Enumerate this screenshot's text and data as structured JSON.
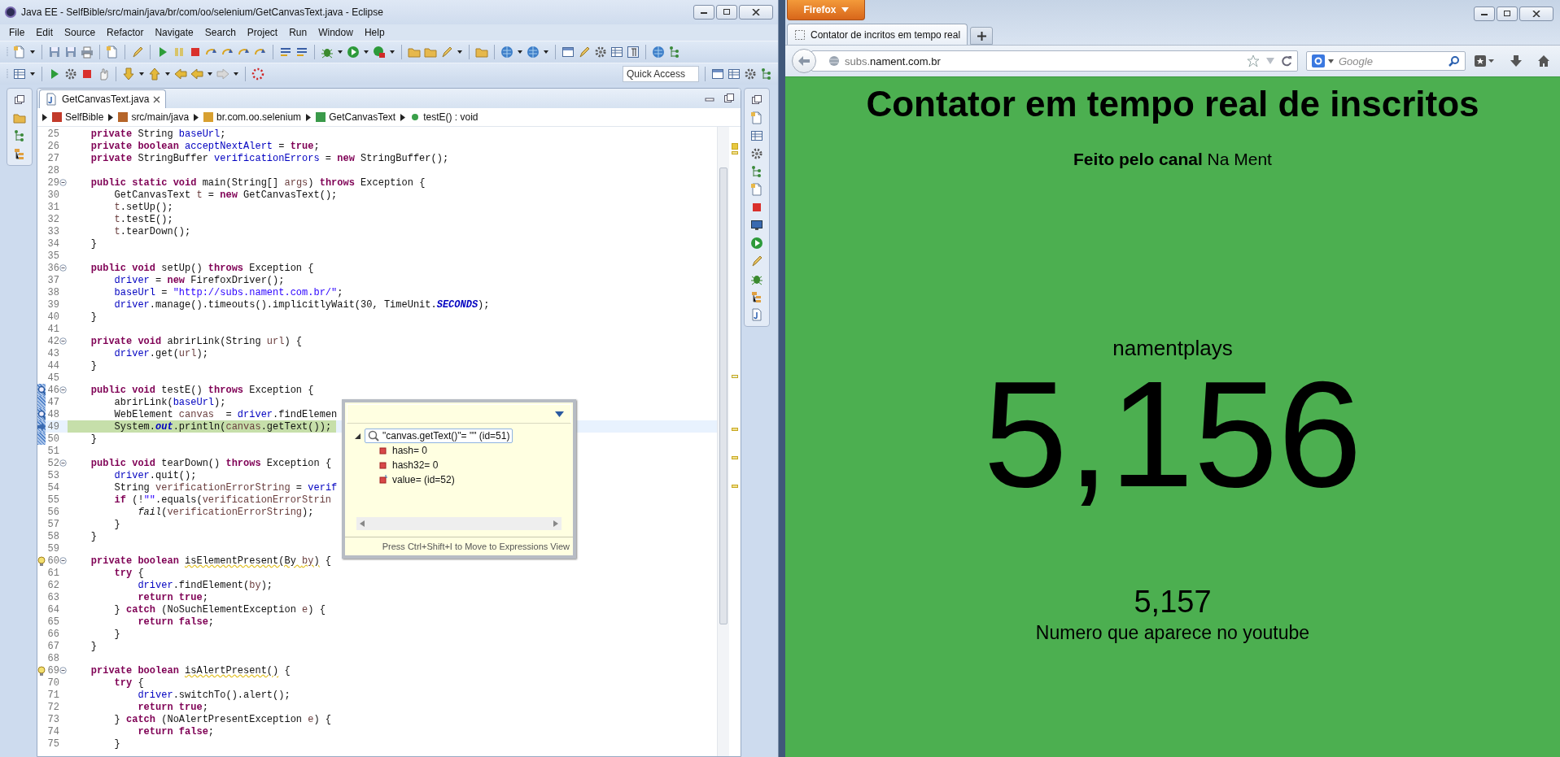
{
  "eclipse": {
    "title": "Java EE - SelfBible/src/main/java/br/com/oo/selenium/GetCanvasText.java - Eclipse",
    "menu": [
      "File",
      "Edit",
      "Source",
      "Refactor",
      "Navigate",
      "Search",
      "Project",
      "Run",
      "Window",
      "Help"
    ],
    "quick_access": {
      "placeholder": "Quick Access"
    },
    "editor_tabs": [
      {
        "label": "GetCanvasText.java",
        "selected": true
      }
    ],
    "breadcrumb": [
      {
        "label": "SelfBible",
        "kind": "project"
      },
      {
        "label": "src/main/java",
        "kind": "source"
      },
      {
        "label": "br.com.oo.selenium",
        "kind": "package"
      },
      {
        "label": "GetCanvasText",
        "kind": "class"
      },
      {
        "label": "testE() : void",
        "kind": "method"
      }
    ],
    "lines": [
      {
        "n": "25",
        "fold": false,
        "current": false,
        "t": [
          {
            "kind": "keyword",
            "text": "    private"
          },
          {
            "kind": "plain",
            "text": " String "
          },
          {
            "kind": "field",
            "text": "baseUrl"
          },
          {
            "kind": "plain",
            "text": ";"
          }
        ]
      },
      {
        "n": "26",
        "fold": false,
        "current": false,
        "t": [
          {
            "kind": "keyword",
            "text": "    private"
          },
          {
            "kind": "keyword",
            "text": " boolean"
          },
          {
            "kind": "field",
            "text": " acceptNextAlert"
          },
          {
            "kind": "plain",
            "text": " = "
          },
          {
            "kind": "keyword",
            "text": "true"
          },
          {
            "kind": "plain",
            "text": ";"
          }
        ]
      },
      {
        "n": "27",
        "fold": false,
        "current": false,
        "t": [
          {
            "kind": "keyword",
            "text": "    private"
          },
          {
            "kind": "plain",
            "text": " StringBuffer "
          },
          {
            "kind": "field",
            "text": "verificationErrors"
          },
          {
            "kind": "plain",
            "text": " = "
          },
          {
            "kind": "keyword",
            "text": "new"
          },
          {
            "kind": "plain",
            "text": " StringBuffer();"
          }
        ]
      },
      {
        "n": "28",
        "fold": false,
        "current": false
      },
      {
        "n": "29",
        "fold": true,
        "current": false,
        "t": [
          {
            "kind": "keyword",
            "text": "    public"
          },
          {
            "kind": "keyword",
            "text": " static"
          },
          {
            "kind": "keyword",
            "text": " void"
          },
          {
            "kind": "plain",
            "text": " main(String[] "
          },
          {
            "kind": "local",
            "text": "args"
          },
          {
            "kind": "plain",
            "text": ") "
          },
          {
            "kind": "keyword",
            "text": "throws"
          },
          {
            "kind": "plain",
            "text": " Exception {"
          }
        ]
      },
      {
        "n": "30",
        "fold": false,
        "current": false,
        "t": [
          {
            "kind": "plain",
            "text": "        GetCanvasText "
          },
          {
            "kind": "local",
            "text": "t"
          },
          {
            "kind": "plain",
            "text": " = "
          },
          {
            "kind": "keyword",
            "text": "new"
          },
          {
            "kind": "plain",
            "text": " GetCanvasText();"
          }
        ]
      },
      {
        "n": "31",
        "fold": false,
        "current": false,
        "t": [
          {
            "kind": "local",
            "text": "        t"
          },
          {
            "kind": "plain",
            "text": ".setUp();"
          }
        ]
      },
      {
        "n": "32",
        "fold": false,
        "current": false,
        "t": [
          {
            "kind": "local",
            "text": "        t"
          },
          {
            "kind": "plain",
            "text": ".testE();"
          }
        ]
      },
      {
        "n": "33",
        "fold": false,
        "current": false,
        "t": [
          {
            "kind": "local",
            "text": "        t"
          },
          {
            "kind": "plain",
            "text": ".tearDown();"
          }
        ]
      },
      {
        "n": "34",
        "fold": false,
        "current": false,
        "t": [
          {
            "kind": "plain",
            "text": "    }"
          }
        ]
      },
      {
        "n": "35",
        "fold": false,
        "current": false
      },
      {
        "n": "36",
        "fold": true,
        "current": false,
        "t": [
          {
            "kind": "keyword",
            "text": "    public"
          },
          {
            "kind": "keyword",
            "text": " void"
          },
          {
            "kind": "plain",
            "text": " setUp() "
          },
          {
            "kind": "keyword",
            "text": "throws"
          },
          {
            "kind": "plain",
            "text": " Exception {"
          }
        ]
      },
      {
        "n": "37",
        "fold": false,
        "current": false,
        "t": [
          {
            "kind": "field",
            "text": "        driver"
          },
          {
            "kind": "plain",
            "text": " = "
          },
          {
            "kind": "keyword",
            "text": "new"
          },
          {
            "kind": "plain",
            "text": " FirefoxDriver();"
          }
        ]
      },
      {
        "n": "38",
        "fold": false,
        "current": false,
        "t": [
          {
            "kind": "field",
            "text": "        baseUrl"
          },
          {
            "kind": "plain",
            "text": " = "
          },
          {
            "kind": "string",
            "text": "\"http://subs.nament.com.br/\""
          },
          {
            "kind": "plain",
            "text": ";"
          }
        ]
      },
      {
        "n": "39",
        "fold": false,
        "current": false,
        "t": [
          {
            "kind": "field",
            "text": "        driver"
          },
          {
            "kind": "plain",
            "text": ".manage().timeouts().implicitlyWait(30, TimeUnit."
          },
          {
            "kind": "static",
            "text": "SECONDS"
          },
          {
            "kind": "plain",
            "text": ");"
          }
        ]
      },
      {
        "n": "40",
        "fold": false,
        "current": false,
        "t": [
          {
            "kind": "plain",
            "text": "    }"
          }
        ]
      },
      {
        "n": "41",
        "fold": false,
        "current": false
      },
      {
        "n": "42",
        "fold": true,
        "current": false,
        "t": [
          {
            "kind": "keyword",
            "text": "    private"
          },
          {
            "kind": "keyword",
            "text": " void"
          },
          {
            "kind": "plain",
            "text": " abrirLink(String "
          },
          {
            "kind": "local",
            "text": "url"
          },
          {
            "kind": "plain",
            "text": ") {"
          }
        ]
      },
      {
        "n": "43",
        "fold": false,
        "current": false,
        "t": [
          {
            "kind": "field",
            "text": "        driver"
          },
          {
            "kind": "plain",
            "text": ".get("
          },
          {
            "kind": "local",
            "text": "url"
          },
          {
            "kind": "plain",
            "text": ");"
          }
        ]
      },
      {
        "n": "44",
        "fold": false,
        "current": false,
        "t": [
          {
            "kind": "plain",
            "text": "    }"
          }
        ]
      },
      {
        "n": "45",
        "fold": false,
        "current": false
      },
      {
        "n": "46",
        "fold": true,
        "current": false,
        "kind": "breakpoint",
        "t": [
          {
            "kind": "keyword",
            "text": "    public"
          },
          {
            "kind": "keyword",
            "text": " void"
          },
          {
            "kind": "plain",
            "text": " testE() "
          },
          {
            "kind": "keyword",
            "text": "throws"
          },
          {
            "kind": "plain",
            "text": " Exception {"
          }
        ]
      },
      {
        "n": "47",
        "fold": false,
        "current": false,
        "kind": "frame",
        "t": [
          {
            "kind": "plain",
            "text": "        abrirLink("
          },
          {
            "kind": "field",
            "text": "baseUrl"
          },
          {
            "kind": "plain",
            "text": ");"
          }
        ]
      },
      {
        "n": "48",
        "fold": false,
        "current": false,
        "kind": "breakpoint",
        "t": [
          {
            "kind": "plain",
            "text": "        WebElement "
          },
          {
            "kind": "local",
            "text": "canvas"
          },
          {
            "kind": "plain",
            "text": "  = "
          },
          {
            "kind": "field",
            "text": "driver"
          },
          {
            "kind": "plain",
            "text": ".findElemen"
          }
        ]
      },
      {
        "n": "49",
        "fold": false,
        "current": true,
        "kind": "ip",
        "t": [
          {
            "kind": "plain",
            "text": "        System."
          },
          {
            "kind": "static",
            "text": "out"
          },
          {
            "kind": "plain",
            "text": ".println("
          },
          {
            "kind": "local",
            "text": "canvas"
          },
          {
            "kind": "plain",
            "text": ".getText());"
          }
        ]
      },
      {
        "n": "50",
        "fold": false,
        "current": false,
        "kind": "frame",
        "t": [
          {
            "kind": "plain",
            "text": "    }"
          }
        ]
      },
      {
        "n": "51",
        "fold": false,
        "current": false
      },
      {
        "n": "52",
        "fold": true,
        "current": false,
        "t": [
          {
            "kind": "keyword",
            "text": "    public"
          },
          {
            "kind": "keyword",
            "text": " void"
          },
          {
            "kind": "plain",
            "text": " tearDown() "
          },
          {
            "kind": "keyword",
            "text": "throws"
          },
          {
            "kind": "plain",
            "text": " Exception {"
          }
        ]
      },
      {
        "n": "53",
        "fold": false,
        "current": false,
        "t": [
          {
            "kind": "field",
            "text": "        driver"
          },
          {
            "kind": "plain",
            "text": ".quit();"
          }
        ]
      },
      {
        "n": "54",
        "fold": false,
        "current": false,
        "t": [
          {
            "kind": "plain",
            "text": "        String "
          },
          {
            "kind": "local",
            "text": "verificationErrorString"
          },
          {
            "kind": "plain",
            "text": " = "
          },
          {
            "kind": "field",
            "text": "verif"
          }
        ]
      },
      {
        "n": "55",
        "fold": false,
        "current": false,
        "t": [
          {
            "kind": "keyword",
            "text": "        if"
          },
          {
            "kind": "plain",
            "text": " (!"
          },
          {
            "kind": "string",
            "text": "\"\""
          },
          {
            "kind": "plain",
            "text": ".equals("
          },
          {
            "kind": "local",
            "text": "verificationErrorStrin"
          }
        ]
      },
      {
        "n": "56",
        "fold": false,
        "current": false,
        "t": [
          {
            "kind": "italic",
            "text": "            fail"
          },
          {
            "kind": "plain",
            "text": "("
          },
          {
            "kind": "local",
            "text": "verificationErrorString"
          },
          {
            "kind": "plain",
            "text": ");"
          }
        ]
      },
      {
        "n": "57",
        "fold": false,
        "current": false,
        "t": [
          {
            "kind": "plain",
            "text": "        }"
          }
        ]
      },
      {
        "n": "58",
        "fold": false,
        "current": false,
        "t": [
          {
            "kind": "plain",
            "text": "    }"
          }
        ]
      },
      {
        "n": "59",
        "fold": false,
        "current": false
      },
      {
        "n": "60",
        "fold": true,
        "current": false,
        "kind": "warning",
        "t": [
          {
            "kind": "keyword",
            "text": "    private"
          },
          {
            "kind": "keyword",
            "text": " boolean "
          },
          {
            "kind": "warn",
            "text": "isElementPresent(By "
          },
          {
            "kind": "warnlocal",
            "text": "by"
          },
          {
            "kind": "warn",
            "text": ")"
          },
          {
            "kind": "plain",
            "text": " {"
          }
        ]
      },
      {
        "n": "61",
        "fold": false,
        "current": false,
        "t": [
          {
            "kind": "keyword",
            "text": "        try"
          },
          {
            "kind": "plain",
            "text": " {"
          }
        ]
      },
      {
        "n": "62",
        "fold": false,
        "current": false,
        "t": [
          {
            "kind": "field",
            "text": "            driver"
          },
          {
            "kind": "plain",
            "text": ".findElement("
          },
          {
            "kind": "local",
            "text": "by"
          },
          {
            "kind": "plain",
            "text": ");"
          }
        ]
      },
      {
        "n": "63",
        "fold": false,
        "current": false,
        "t": [
          {
            "kind": "keyword",
            "text": "            return"
          },
          {
            "kind": "keyword",
            "text": " true"
          },
          {
            "kind": "plain",
            "text": ";"
          }
        ]
      },
      {
        "n": "64",
        "fold": false,
        "current": false,
        "t": [
          {
            "kind": "plain",
            "text": "        } "
          },
          {
            "kind": "keyword",
            "text": "catch"
          },
          {
            "kind": "plain",
            "text": " (NoSuchElementException "
          },
          {
            "kind": "local",
            "text": "e"
          },
          {
            "kind": "plain",
            "text": ") {"
          }
        ]
      },
      {
        "n": "65",
        "fold": false,
        "current": false,
        "t": [
          {
            "kind": "keyword",
            "text": "            return"
          },
          {
            "kind": "keyword",
            "text": " false"
          },
          {
            "kind": "plain",
            "text": ";"
          }
        ]
      },
      {
        "n": "66",
        "fold": false,
        "current": false,
        "t": [
          {
            "kind": "plain",
            "text": "        }"
          }
        ]
      },
      {
        "n": "67",
        "fold": false,
        "current": false,
        "t": [
          {
            "kind": "plain",
            "text": "    }"
          }
        ]
      },
      {
        "n": "68",
        "fold": false,
        "current": false
      },
      {
        "n": "69",
        "fold": true,
        "current": false,
        "kind": "warning",
        "t": [
          {
            "kind": "keyword",
            "text": "    private"
          },
          {
            "kind": "keyword",
            "text": " boolean "
          },
          {
            "kind": "warn",
            "text": "isAlertPresent()"
          },
          {
            "kind": "plain",
            "text": " {"
          }
        ]
      },
      {
        "n": "70",
        "fold": false,
        "current": false,
        "t": [
          {
            "kind": "keyword",
            "text": "        try"
          },
          {
            "kind": "plain",
            "text": " {"
          }
        ]
      },
      {
        "n": "71",
        "fold": false,
        "current": false,
        "t": [
          {
            "kind": "field",
            "text": "            driver"
          },
          {
            "kind": "plain",
            "text": ".switchTo().alert();"
          }
        ]
      },
      {
        "n": "72",
        "fold": false,
        "current": false,
        "t": [
          {
            "kind": "keyword",
            "text": "            return"
          },
          {
            "kind": "keyword",
            "text": " true"
          },
          {
            "kind": "plain",
            "text": ";"
          }
        ]
      },
      {
        "n": "73",
        "fold": false,
        "current": false,
        "t": [
          {
            "kind": "plain",
            "text": "        } "
          },
          {
            "kind": "keyword",
            "text": "catch"
          },
          {
            "kind": "plain",
            "text": " (NoAlertPresentException "
          },
          {
            "kind": "local",
            "text": "e"
          },
          {
            "kind": "plain",
            "text": ") {"
          }
        ]
      },
      {
        "n": "74",
        "fold": false,
        "current": false,
        "t": [
          {
            "kind": "keyword",
            "text": "            return"
          },
          {
            "kind": "keyword",
            "text": " false"
          },
          {
            "kind": "plain",
            "text": ";"
          }
        ]
      },
      {
        "n": "75",
        "fold": false,
        "current": false,
        "t": [
          {
            "kind": "plain",
            "text": "        }"
          }
        ]
      }
    ],
    "inspect_popup": {
      "expression": "\"canvas.getText()\"= \"\" (id=51)",
      "expanded": true,
      "children": [
        {
          "label": "hash= 0",
          "kind": "field"
        },
        {
          "label": "hash32= 0",
          "kind": "field"
        },
        {
          "label": "value= (id=52)",
          "kind": "final"
        }
      ],
      "hint": "Press Ctrl+Shift+I to Move to Expressions View"
    }
  },
  "firefox": {
    "menu_button": "Firefox",
    "tabs": [
      {
        "title": "Contator de incritos em tempo real",
        "selected": true
      }
    ],
    "url": {
      "subdomain": "subs.",
      "domain": "nament.com.br"
    },
    "search": {
      "placeholder": "Google"
    },
    "page": {
      "heading": "Contator em tempo real de inscritos",
      "credit": "**Feito pelo canal** Na Ment",
      "channel": "namentplays",
      "count": "5,156",
      "youtube_count": "5,157",
      "youtube_caption": "Numero que aparece no youtube"
    }
  }
}
